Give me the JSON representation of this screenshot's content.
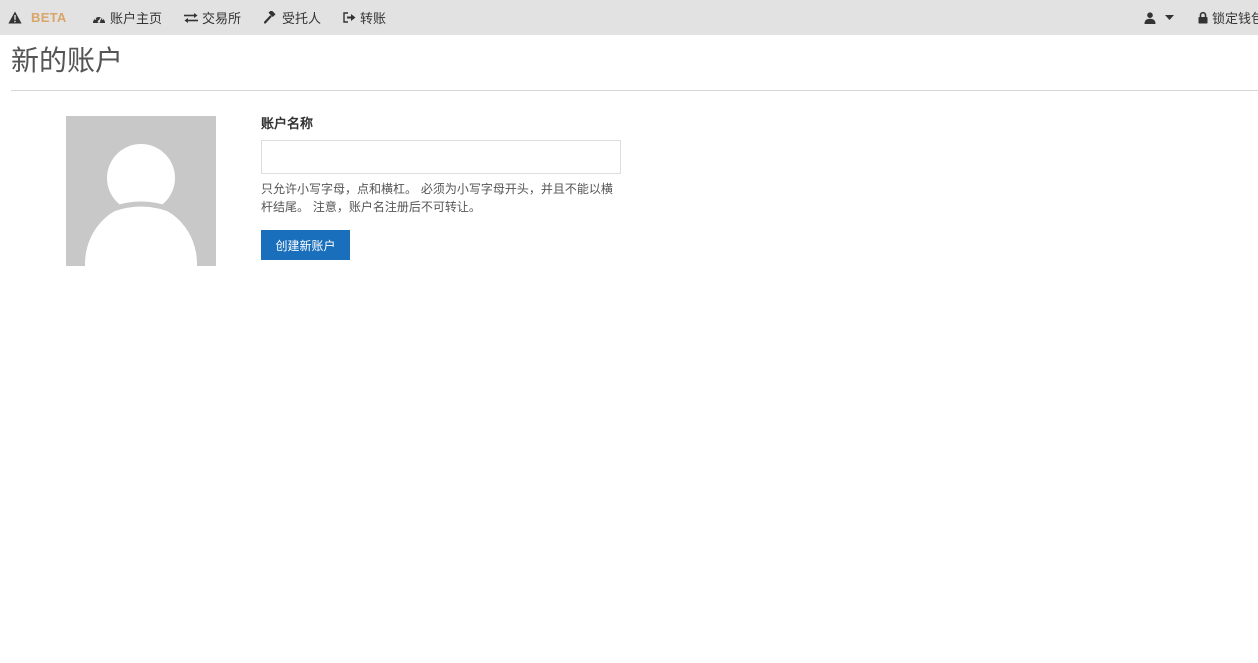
{
  "nav": {
    "beta_label": "BETA",
    "items": [
      {
        "label": "账户主页",
        "icon": "dashboard-icon"
      },
      {
        "label": "交易所",
        "icon": "exchange-icon"
      },
      {
        "label": "受托人",
        "icon": "gavel-icon"
      },
      {
        "label": "转账",
        "icon": "transfer-icon"
      }
    ],
    "user_icon": "user-icon",
    "lock_label": "锁定钱包"
  },
  "page": {
    "title": "新的账户"
  },
  "form": {
    "label": "账户名称",
    "input_value": "",
    "help_text": "只允许小写字母，点和横杠。 必须为小写字母开头，并且不能以横杆结尾。 注意，账户名注册后不可转让。",
    "submit_label": "创建新账户"
  },
  "colors": {
    "topbar_bg": "#e2e2e2",
    "beta": "#d9a569",
    "primary_button": "#1a6fbd",
    "avatar_bg": "#c8c8c8"
  }
}
